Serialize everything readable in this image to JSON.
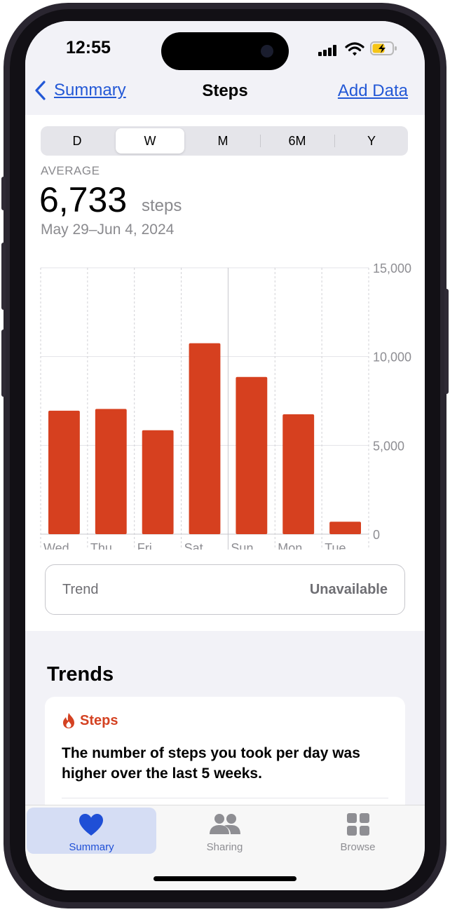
{
  "status_bar": {
    "time": "12:55"
  },
  "nav": {
    "back_label": "Summary",
    "title": "Steps",
    "action_label": "Add Data"
  },
  "segments": {
    "items": [
      "D",
      "W",
      "M",
      "6M",
      "Y"
    ],
    "selected": "W"
  },
  "summary": {
    "label": "AVERAGE",
    "value": "6,733",
    "unit": "steps",
    "date_range": "May 29–Jun 4, 2024"
  },
  "chart_data": {
    "type": "bar",
    "categories": [
      "Wed",
      "Thu",
      "Fri",
      "Sat",
      "Sun",
      "Mon",
      "Tue"
    ],
    "values": [
      6950,
      7050,
      5850,
      10750,
      8850,
      6750,
      700
    ],
    "ylim": [
      0,
      15000
    ],
    "y_ticks": [
      "15,000",
      "10,000",
      "5,000",
      "0"
    ],
    "bar_color": "#d6401f",
    "grid": true
  },
  "trend": {
    "label": "Trend",
    "value": "Unavailable"
  },
  "trends_section": {
    "title": "Trends",
    "card": {
      "icon": "flame-icon",
      "title": "Steps",
      "text": "The number of steps you took per day was higher over the last 5 weeks."
    }
  },
  "tabbar": {
    "items": [
      {
        "label": "Summary",
        "icon": "heart-icon",
        "active": true
      },
      {
        "label": "Sharing",
        "icon": "people-icon",
        "active": false
      },
      {
        "label": "Browse",
        "icon": "grid-icon",
        "active": false
      }
    ],
    "active_color": "#1f4fd6",
    "inactive_color": "#8e8e93"
  }
}
